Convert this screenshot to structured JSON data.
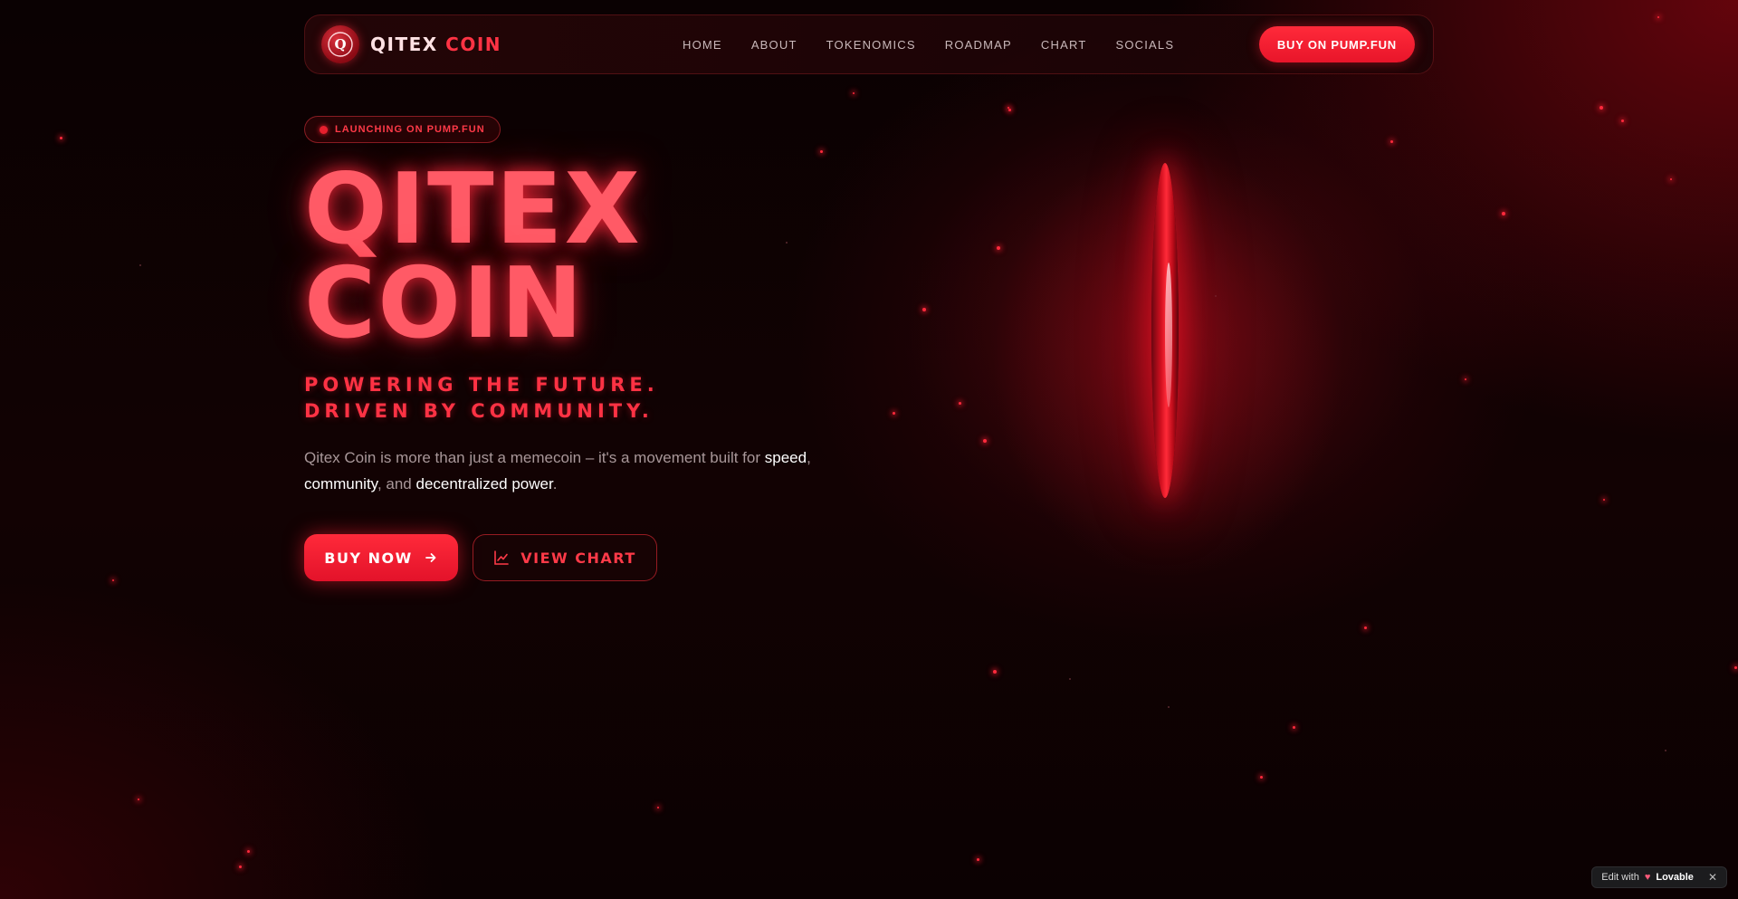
{
  "brand": {
    "name_part1": "QITEX",
    "name_part2": "COIN",
    "logo_letter": "Q"
  },
  "nav": {
    "links": [
      "HOME",
      "ABOUT",
      "TOKENOMICS",
      "ROADMAP",
      "CHART",
      "SOCIALS"
    ],
    "cta_label": "BUY ON PUMP.FUN"
  },
  "hero": {
    "pill_text": "LAUNCHING ON PUMP.FUN",
    "title_line1": "QITEX",
    "title_line2": "COIN",
    "tagline_line1": "POWERING THE FUTURE.",
    "tagline_line2": "DRIVEN BY COMMUNITY.",
    "desc_part1": "Qitex Coin is more than just a memecoin – it's a movement built for ",
    "desc_hl1": "speed",
    "desc_part2": ", ",
    "desc_hl2": "community",
    "desc_part3": ", and ",
    "desc_hl3": "decentralized power",
    "desc_part4": ".",
    "buy_label": "BUY NOW",
    "chart_label": "VIEW CHART"
  },
  "badge": {
    "edit_with": "Edit with",
    "brand": "Lovable"
  },
  "colors": {
    "accent": "#ff2a3a",
    "background": "#0a0102"
  }
}
